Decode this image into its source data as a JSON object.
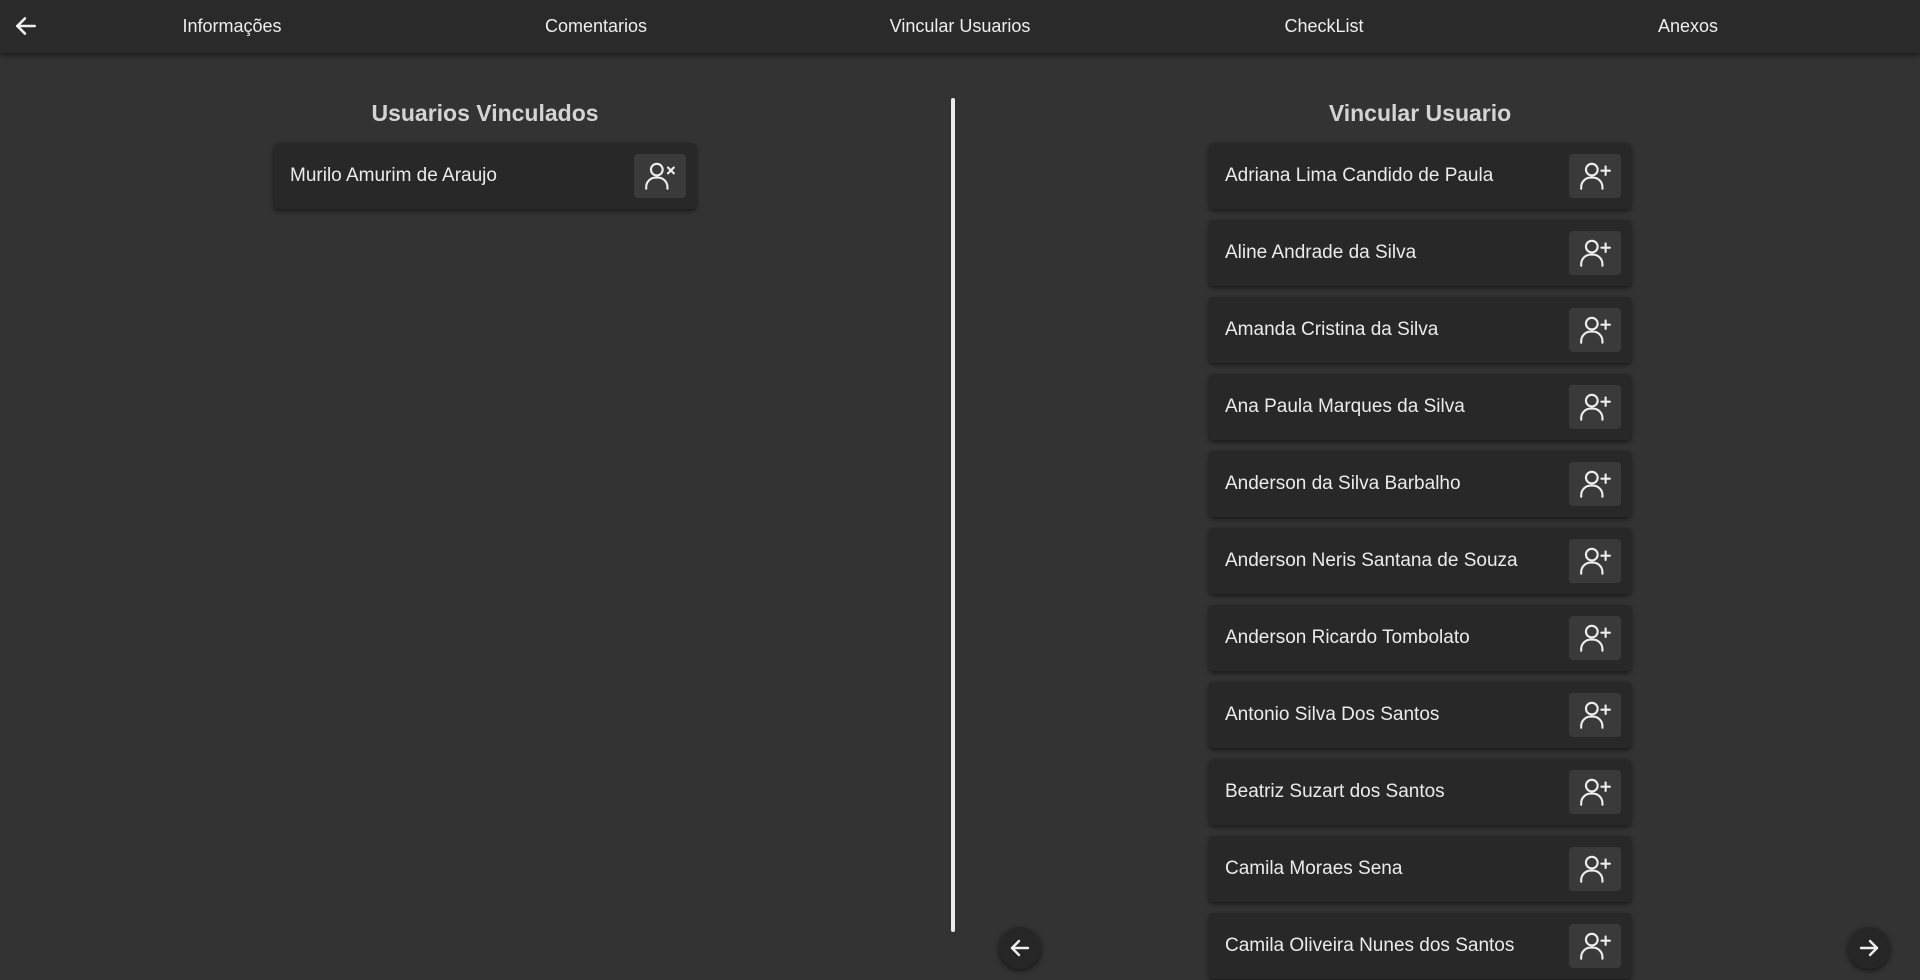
{
  "nav": {
    "back_icon": "arrow-left-icon",
    "tabs": [
      {
        "label": "Informações"
      },
      {
        "label": "Comentarios"
      },
      {
        "label": "Vincular Usuarios"
      },
      {
        "label": "CheckList"
      },
      {
        "label": "Anexos"
      }
    ]
  },
  "linked": {
    "title": "Usuarios Vinculados",
    "action_icon": "user-remove-icon",
    "users": [
      {
        "name": "Murilo Amurim de Araujo"
      }
    ]
  },
  "available": {
    "title": "Vincular Usuario",
    "action_icon": "user-add-icon",
    "users": [
      {
        "name": "Adriana Lima Candido de Paula"
      },
      {
        "name": "Aline Andrade da Silva"
      },
      {
        "name": "Amanda Cristina da Silva"
      },
      {
        "name": "Ana Paula Marques da Silva"
      },
      {
        "name": "Anderson da Silva Barbalho"
      },
      {
        "name": "Anderson Neris Santana de Souza"
      },
      {
        "name": "Anderson Ricardo Tombolato"
      },
      {
        "name": "Antonio Silva Dos Santos"
      },
      {
        "name": "Beatriz Suzart dos Santos"
      },
      {
        "name": "Camila Moraes Sena"
      },
      {
        "name": "Camila Oliveira Nunes dos Santos"
      }
    ]
  },
  "pagination": {
    "prev_icon": "arrow-left-icon",
    "next_icon": "arrow-right-icon"
  },
  "colors": {
    "background": "#333333",
    "card": "#282828",
    "button": "#3a3a3a",
    "text": "#ebebeb",
    "divider": "#ececec"
  }
}
